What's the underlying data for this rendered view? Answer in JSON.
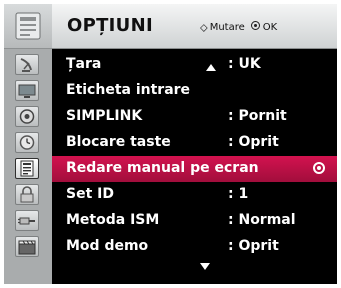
{
  "header": {
    "title": "OPȚIUNI",
    "move_icon": "four-way-arrow-icon",
    "move_label": "Mutare",
    "ok_icon": "ok-circle-icon",
    "ok_label": "OK"
  },
  "rail": {
    "top_icon": "options-pin-icon",
    "items": [
      {
        "icon": "satellite-dish-icon"
      },
      {
        "icon": "tv-screen-icon"
      },
      {
        "icon": "speaker-icon"
      },
      {
        "icon": "clock-icon"
      },
      {
        "icon": "options-icon",
        "active": true
      },
      {
        "icon": "lock-icon"
      },
      {
        "icon": "input-plug-icon"
      },
      {
        "icon": "clapperboard-icon"
      }
    ]
  },
  "menu": {
    "scroll_up_icon": "scroll-up-arrow-icon",
    "scroll_down_icon": "scroll-down-arrow-icon",
    "rows": [
      {
        "label": "Țara",
        "value": ": UK"
      },
      {
        "label": "Eticheta intrare",
        "value": ""
      },
      {
        "label": "SIMPLINK",
        "value": ": Pornit"
      },
      {
        "label": "Blocare taste",
        "value": ": Oprit"
      },
      {
        "label": "Redare manual pe ecran",
        "value": "",
        "selected": true
      },
      {
        "label": "Set ID",
        "value": ": 1"
      },
      {
        "label": "Metoda ISM",
        "value": ": Normal"
      },
      {
        "label": "Mod demo",
        "value": ": Oprit"
      }
    ]
  },
  "colors": {
    "panel_bg": "#000000",
    "highlight": "#c8104a",
    "rail_bg": "#a9acad",
    "text": "#ffffff"
  }
}
